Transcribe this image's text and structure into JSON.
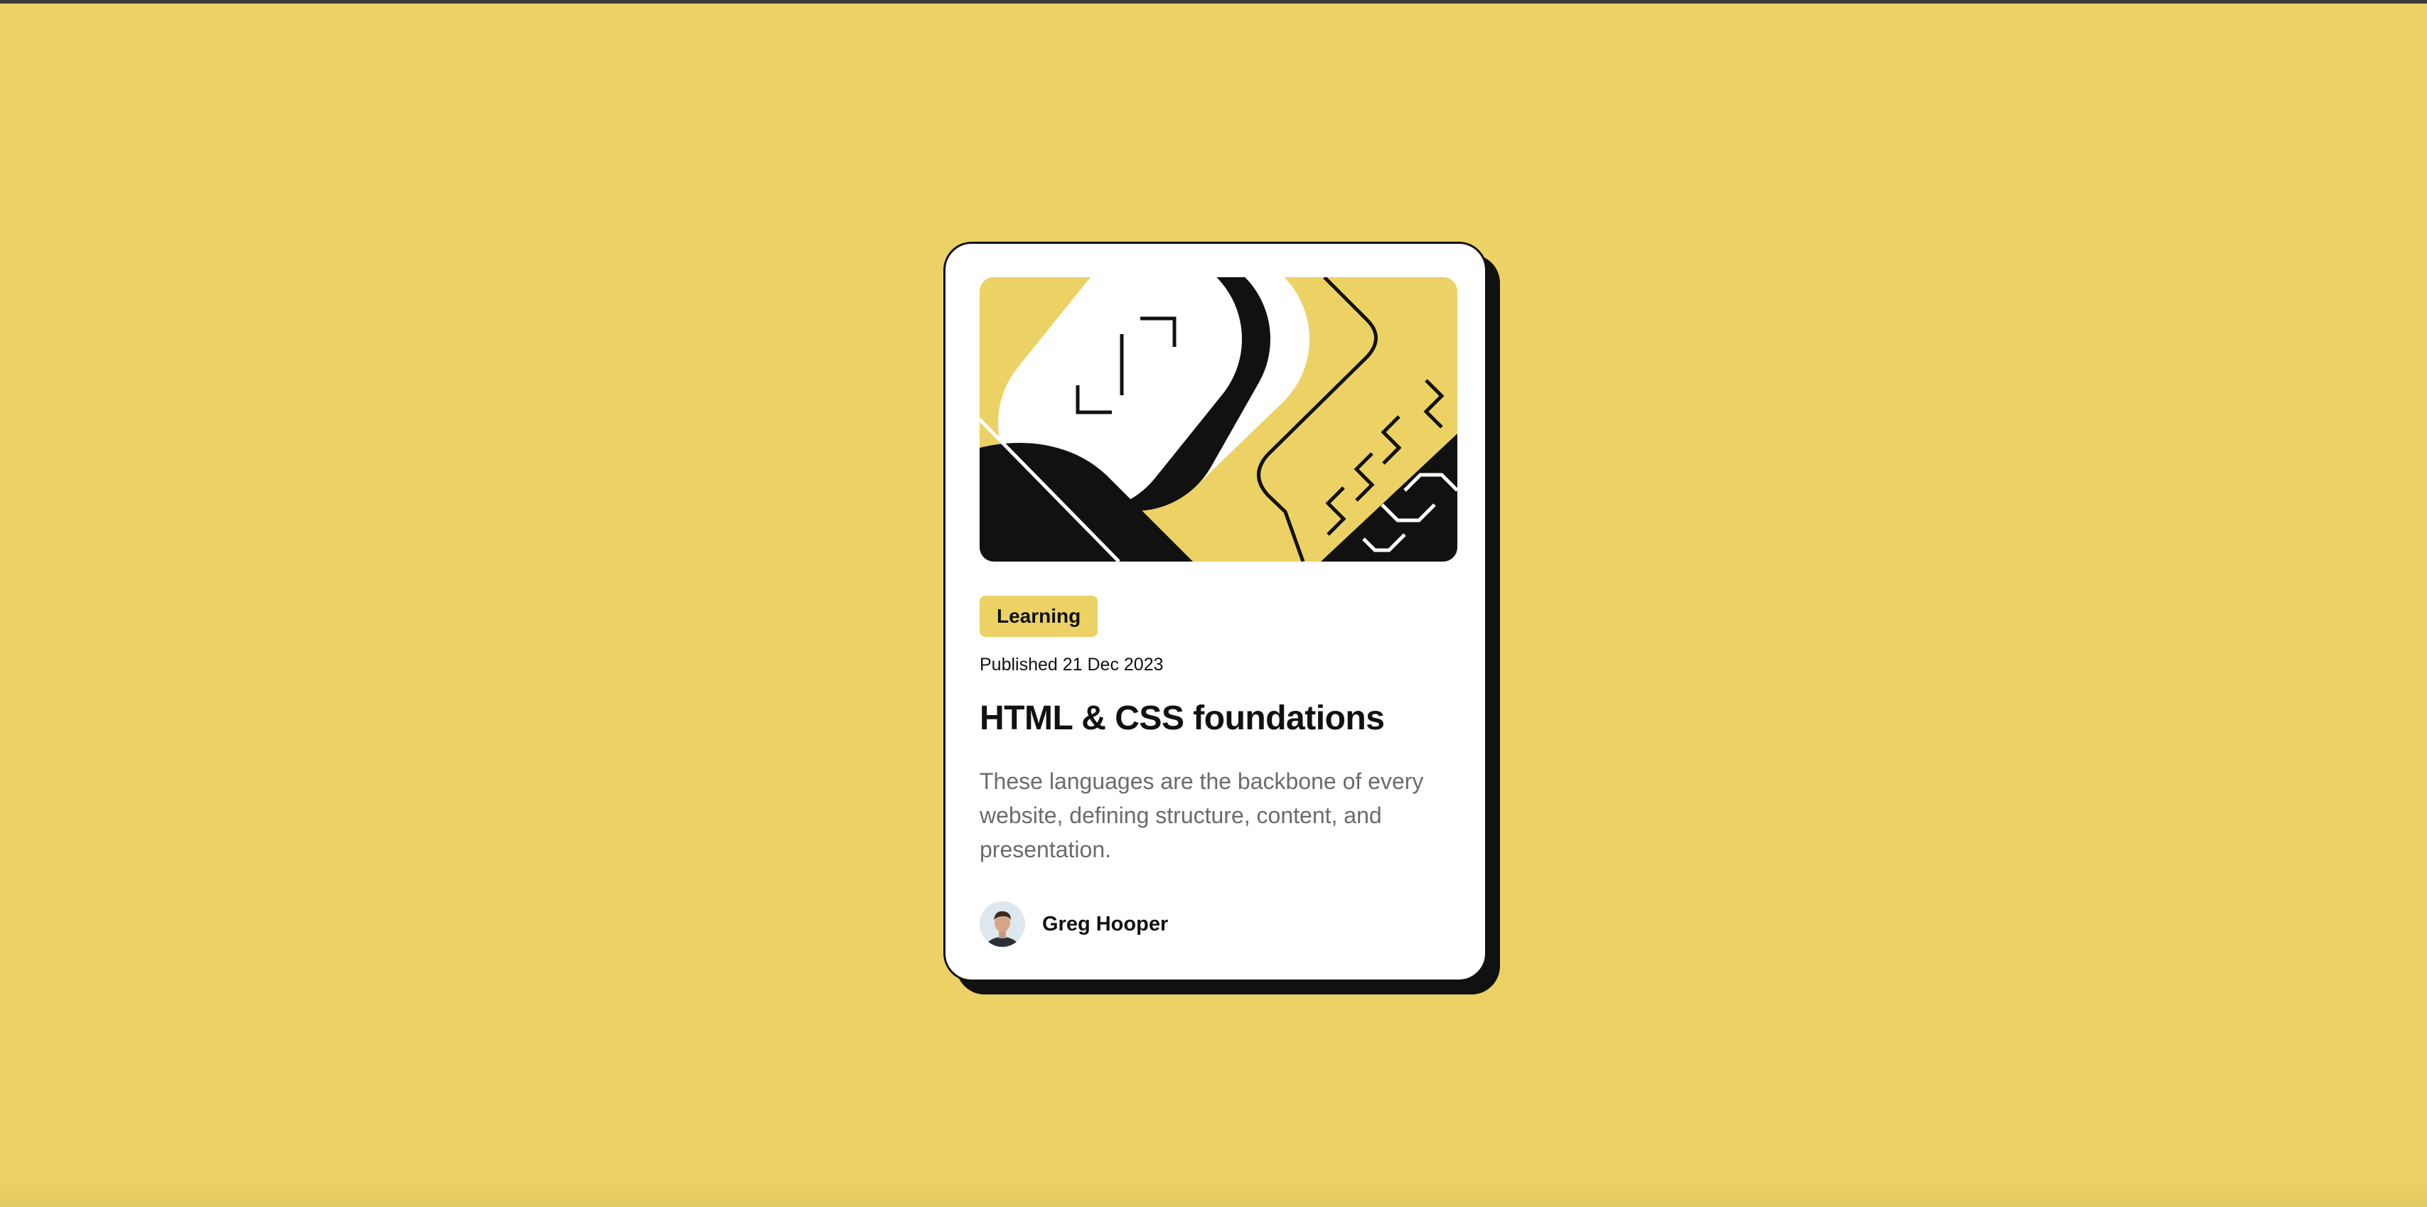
{
  "card": {
    "category": "Learning",
    "published": "Published 21 Dec 2023",
    "title": "HTML & CSS foundations",
    "description": "These languages are the backbone of every website, defining structure, content, and presentation.",
    "author": {
      "name": "Greg Hooper"
    }
  },
  "colors": {
    "background": "#ECD264",
    "accent": "#ECD264",
    "text": "#111111",
    "muted_text": "#6b6b6b",
    "card": "#ffffff"
  }
}
